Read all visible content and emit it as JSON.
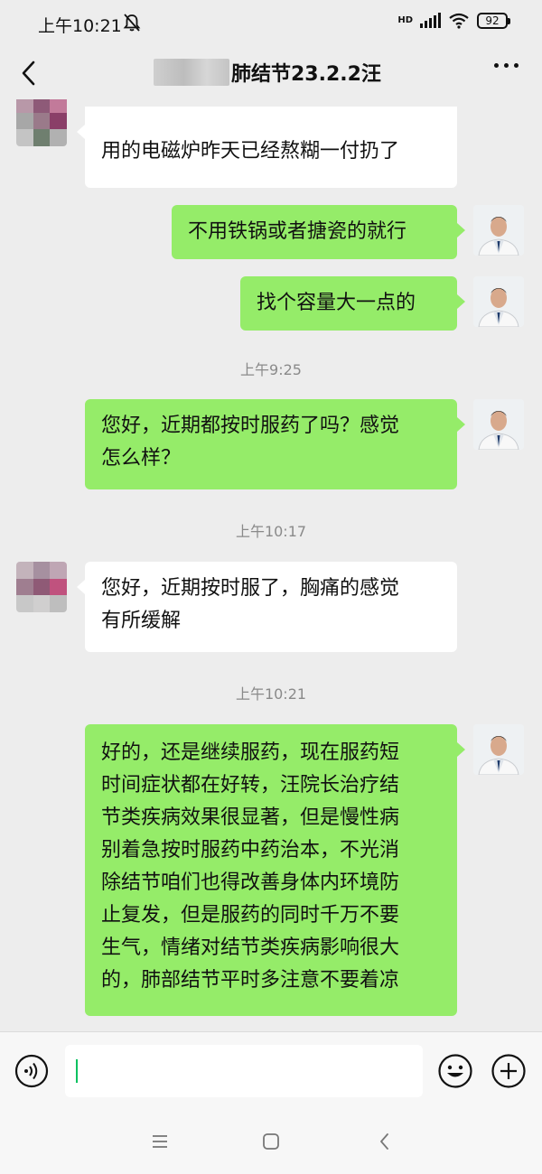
{
  "status_bar": {
    "time": "上午10:21",
    "network": "HD",
    "battery": "92",
    "icons": [
      "do-not-disturb-icon",
      "signal-icon",
      "wifi-icon",
      "battery-icon"
    ]
  },
  "header": {
    "title": "肺结节23.2.2汪",
    "back_icon": "chevron-left-icon",
    "more_icon": "more-dots-icon"
  },
  "messages": [
    {
      "side": "in",
      "text": "用的电磁炉昨天已经熬糊一付扔了"
    },
    {
      "side": "out",
      "text": "不用铁锅或者搪瓷的就行"
    },
    {
      "side": "out",
      "text": "找个容量大一点的"
    },
    {
      "timestamp": "上午9:25"
    },
    {
      "side": "out",
      "text_lines": [
        "您好，近期都按时服药了吗？感觉",
        "怎么样？"
      ]
    },
    {
      "timestamp": "上午10:17"
    },
    {
      "side": "in",
      "text_lines": [
        "您好，近期按时服了，胸痛的感觉",
        "有所缓解"
      ]
    },
    {
      "timestamp": "上午10:21"
    },
    {
      "side": "out",
      "text_lines": [
        "好的，还是继续服药，现在服药短",
        "时间症状都在好转，汪院长治疗结",
        "节类疾病效果很显著，但是慢性病",
        "别着急按时服药中药治本，不光消",
        "除结节咱们也得改善身体内环境防",
        "止复发，但是服药的同时千万不要",
        "生气，情绪对结节类疾病影响很大",
        "的，肺部结节平时多注意不要着凉"
      ]
    }
  ],
  "input_bar": {
    "text_value": "",
    "voice_icon": "voice-icon",
    "emoji_icon": "emoji-icon",
    "plus_icon": "plus-icon",
    "accent_color": "#07c160"
  },
  "nav_bar": {
    "icons": [
      "menu-icon",
      "home-icon",
      "back-icon"
    ]
  },
  "colors": {
    "background": "#ededed",
    "outgoing_bubble": "#95ec69",
    "incoming_bubble": "#ffffff"
  }
}
